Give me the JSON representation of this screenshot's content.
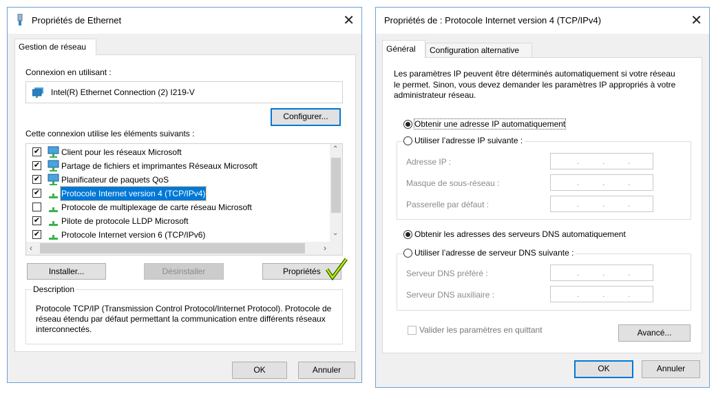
{
  "ethernet": {
    "title": "Propriétés de Ethernet",
    "tab": "Gestion de réseau",
    "connect_label": "Connexion en utilisant :",
    "adapter": "Intel(R) Ethernet Connection (2) I219-V",
    "configure": "Configurer...",
    "items_label": "Cette connexion utilise les éléments suivants :",
    "items": [
      {
        "label": "Client pour les réseaux Microsoft",
        "checked": true,
        "icon": "network-client-icon"
      },
      {
        "label": "Partage de fichiers et imprimantes Réseaux Microsoft",
        "checked": true,
        "icon": "network-service-icon"
      },
      {
        "label": "Planificateur de paquets QoS",
        "checked": true,
        "icon": "network-service-icon"
      },
      {
        "label": "Protocole Internet version 4 (TCP/IPv4)",
        "checked": true,
        "icon": "protocol-icon",
        "selected": true
      },
      {
        "label": "Protocole de multiplexage de carte réseau Microsoft",
        "checked": false,
        "icon": "protocol-icon"
      },
      {
        "label": "Pilote de protocole LLDP Microsoft",
        "checked": true,
        "icon": "protocol-icon"
      },
      {
        "label": "Protocole Internet version 6 (TCP/IPv6)",
        "checked": true,
        "icon": "protocol-icon"
      }
    ],
    "install": "Installer...",
    "uninstall": "Désinstaller",
    "properties": "Propriétés",
    "description_label": "Description",
    "description": "Protocole TCP/IP (Transmission Control Protocol/Internet Protocol). Protocole de réseau étendu par défaut permettant la communication entre différents réseaux interconnectés.",
    "ok": "OK",
    "cancel": "Annuler",
    "accent": "#0078d7"
  },
  "ipv4": {
    "title": "Propriétés de : Protocole Internet version 4 (TCP/IPv4)",
    "tabs": [
      "Général",
      "Configuration alternative"
    ],
    "intro": "Les paramètres IP peuvent être déterminés automatiquement si votre réseau le permet. Sinon, vous devez demander les paramètres IP appropriés à votre administrateur réseau.",
    "ip_auto": "Obtenir une adresse IP automatiquement",
    "ip_manual": "Utiliser l’adresse IP suivante :",
    "ip_fields": [
      "Adresse IP :",
      "Masque de sous-réseau :",
      "Passerelle par défaut :"
    ],
    "dns_auto": "Obtenir les adresses des serveurs DNS automatiquement",
    "dns_manual": "Utiliser l’adresse de serveur DNS suivante :",
    "dns_fields": [
      "Serveur DNS préféré :",
      "Serveur DNS auxiliaire :"
    ],
    "validate": "Valider les paramètres en quittant",
    "advanced": "Avancé...",
    "ok": "OK",
    "cancel": "Annuler"
  }
}
